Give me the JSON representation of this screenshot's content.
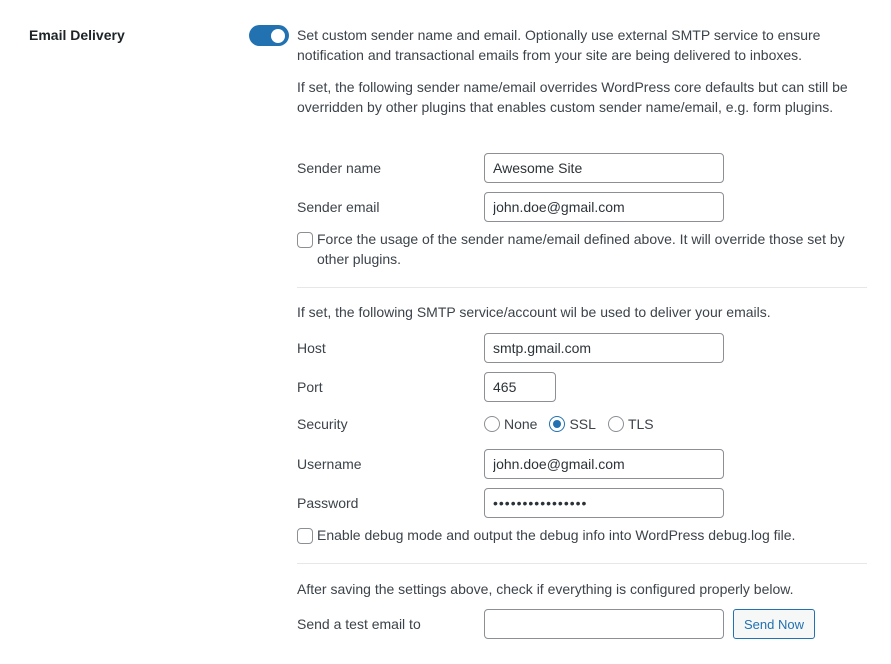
{
  "section": {
    "title": "Email Delivery",
    "toggle": {
      "state": "on",
      "accent": "#2271b1"
    }
  },
  "intro": {
    "description": "Set custom sender name and email. Optionally use external SMTP service to ensure notification and transactional emails from your site are being delivered to inboxes.",
    "sender_note": "If set, the following sender name/email overrides WordPress core defaults but can still be overridden by other plugins that enables custom sender name/email, e.g. form plugins."
  },
  "sender": {
    "name_label": "Sender name",
    "name_value": "Awesome Site",
    "email_label": "Sender email",
    "email_value": "john.doe@gmail.com",
    "force_label": "Force the usage of the sender name/email defined above. It will override those set by other plugins.",
    "force_checked": false
  },
  "smtp": {
    "note": "If set, the following SMTP service/account wil be used to deliver your emails.",
    "host_label": "Host",
    "host_value": "smtp.gmail.com",
    "port_label": "Port",
    "port_value": "465",
    "security_label": "Security",
    "security_options": [
      "None",
      "SSL",
      "TLS"
    ],
    "security_selected": "SSL",
    "username_label": "Username",
    "username_value": "john.doe@gmail.com",
    "password_label": "Password",
    "password_masked": "••••••••••••••••",
    "debug_label": "Enable debug mode and output the debug info into WordPress debug.log file.",
    "debug_checked": false
  },
  "test": {
    "note": "After saving the settings above, check if everything is configured properly below.",
    "label": "Send a test email to",
    "input_value": "",
    "button_label": "Send Now"
  }
}
